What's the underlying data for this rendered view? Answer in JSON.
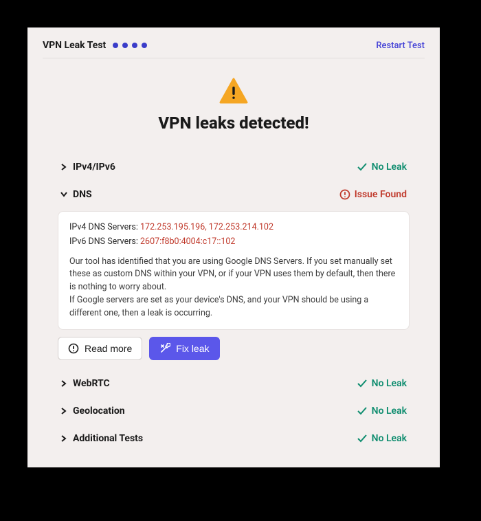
{
  "header": {
    "title": "VPN Leak Test",
    "restart": "Restart Test",
    "progress_dots": 4
  },
  "hero": {
    "heading": "VPN leaks detected!"
  },
  "status_labels": {
    "ok": "No Leak",
    "issue": "Issue Found"
  },
  "sections": {
    "ipv": {
      "label": "IPv4/IPv6",
      "status": "ok"
    },
    "dns": {
      "label": "DNS",
      "status": "issue",
      "ipv4_label": "IPv4 DNS Servers:",
      "ipv4_val": "172.253.195.196, 172.253.214.102",
      "ipv6_label": "IPv6 DNS Servers:",
      "ipv6_val": "2607:f8b0:4004:c17::102",
      "para1": "Our tool has identified that you are using Google DNS Servers. If you set manually set these as custom DNS within your VPN, or if your VPN uses them by default, then there is nothing to worry about.",
      "para2": "If Google servers are set as your device's DNS, and your VPN should be using a different one, then a leak is occurring.",
      "read_more": "Read more",
      "fix_leak": "Fix leak"
    },
    "webrtc": {
      "label": "WebRTC",
      "status": "ok"
    },
    "geo": {
      "label": "Geolocation",
      "status": "ok"
    },
    "additional": {
      "label": "Additional Tests",
      "status": "ok"
    }
  }
}
